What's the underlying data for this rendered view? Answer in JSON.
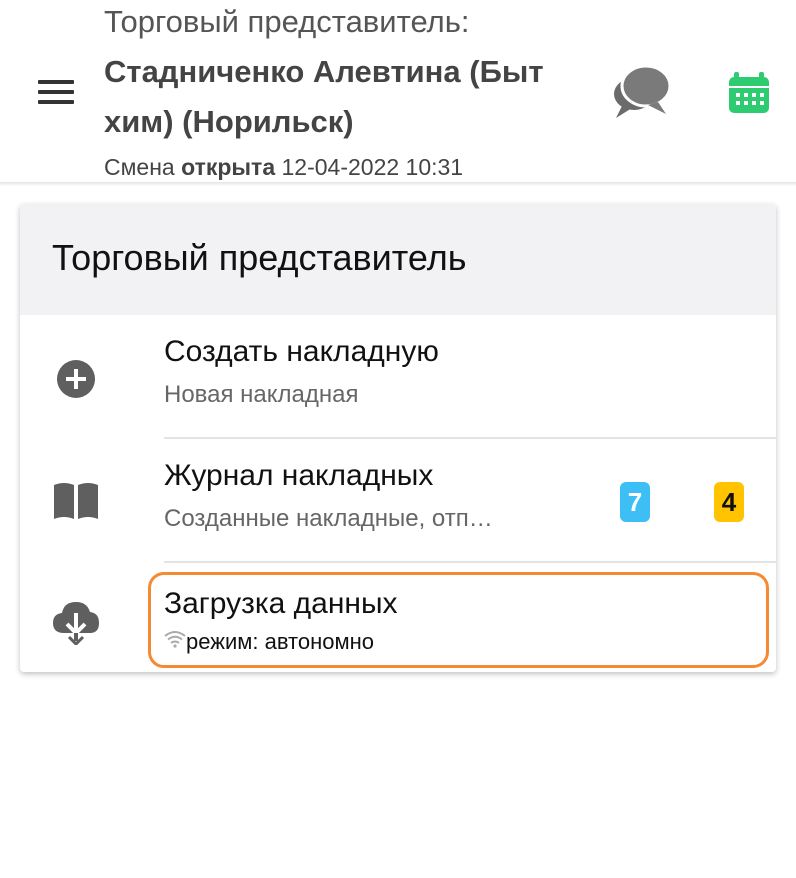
{
  "header": {
    "role_label": "Торговый представитель:",
    "agent_name": "Стадниченко Алевтина (Быт хим) (Норильск)",
    "shift": {
      "prefix": "Смена",
      "status": "открыта",
      "datetime": "12-04-2022 10:31"
    },
    "icons": {
      "menu": "menu-icon",
      "chat": "chat-bubbles-icon",
      "calendar": "calendar-icon"
    },
    "colors": {
      "calendar": "#2ecc71",
      "chat": "#6b6b6b"
    }
  },
  "card": {
    "title": "Торговый представитель",
    "items": [
      {
        "title": "Создать накладную",
        "subtitle": "Новая накладная",
        "icon": "add-circle-icon"
      },
      {
        "title": "Журнал накладных",
        "subtitle": "Созданные накладные, отп…",
        "icon": "book-icon",
        "badges": [
          {
            "value": "7",
            "color": "#3dbff6"
          },
          {
            "value": "4",
            "color": "#ffc300"
          }
        ]
      },
      {
        "title": "Загрузка данных",
        "subtitle": "режим: автономно",
        "icon": "cloud-download-icon",
        "status_icon": "wifi-icon"
      }
    ]
  }
}
